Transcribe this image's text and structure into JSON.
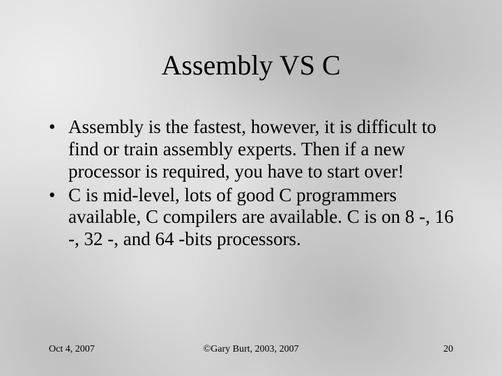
{
  "title": "Assembly VS C",
  "bullets": [
    "Assembly is the fastest, however, it is difficult to find or train assembly experts. Then if a new processor is required, you have to start over!",
    "C is mid-level, lots of good C programmers available, C compilers are available.  C is on 8 -, 16 -, 32 -, and 64 -bits processors."
  ],
  "footer": {
    "date": "Oct 4, 2007",
    "copyright": "©Gary Burt, 2003, 2007",
    "page": "20"
  }
}
